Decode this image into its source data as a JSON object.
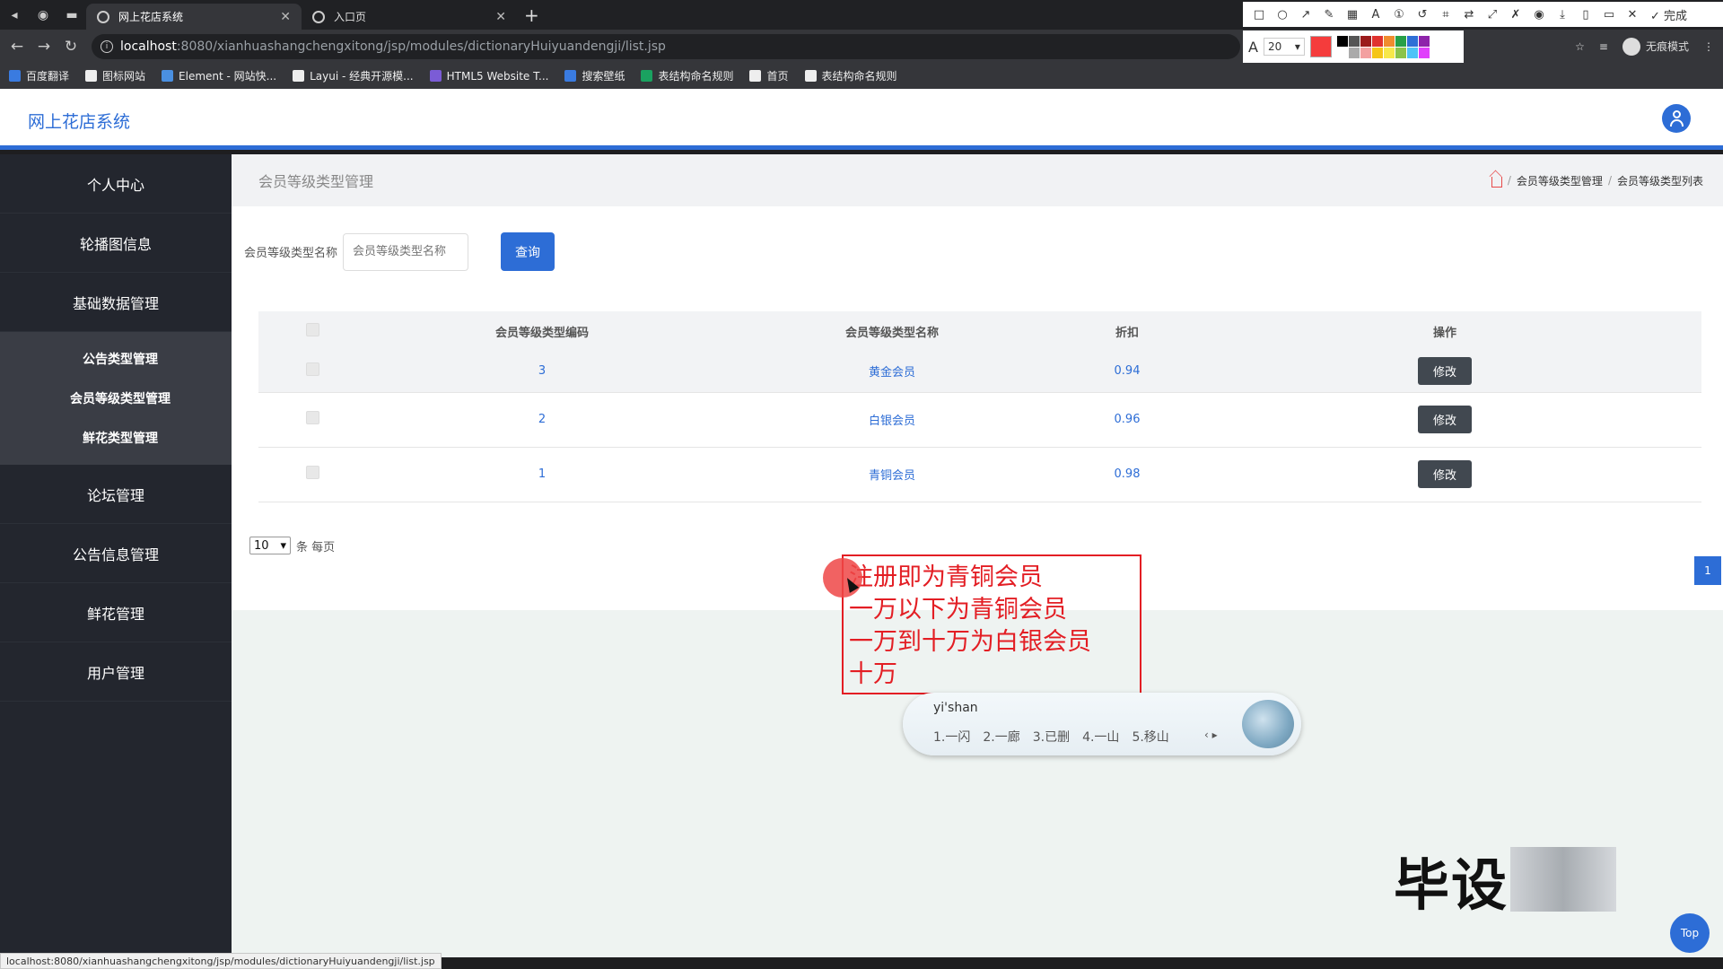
{
  "browser": {
    "tabs": [
      {
        "title": "网上花店系统",
        "active": true
      },
      {
        "title": "入口页",
        "active": false
      }
    ],
    "url_host": "localhost",
    "url_path": ":8080/xianhuashangchengxitong/jsp/modules/dictionaryHuiyuandengji/list.jsp",
    "incognito_label": "无痕模式",
    "bookmarks": [
      {
        "label": "百度翻译",
        "color": "#3a7be0"
      },
      {
        "label": "图标网站",
        "color": "#eeeeee"
      },
      {
        "label": "Element - 网站快...",
        "color": "#4a90e2"
      },
      {
        "label": "Layui - 经典开源模...",
        "color": "#eeeeee"
      },
      {
        "label": "HTML5 Website T...",
        "color": "#7b5cd6"
      },
      {
        "label": "搜索壁纸",
        "color": "#3a7be0"
      },
      {
        "label": "表结构命名规则",
        "color": "#1aa260"
      },
      {
        "label": "首页",
        "color": "#eeeeee"
      },
      {
        "label": "表结构命名规则",
        "color": "#eeeeee"
      }
    ],
    "status_url": "localhost:8080/xianhuashangchengxitong/jsp/modules/dictionaryHuiyuandengji/list.jsp"
  },
  "annotation_tool": {
    "font_size": "20",
    "done_label": "完成",
    "current_color": "#f53c3c",
    "palette": [
      "#000000",
      "#555555",
      "#9b1c1c",
      "#e0322e",
      "#f08c2e",
      "#27a047",
      "#2e6fd6",
      "#8e24aa",
      "#ffffff",
      "#aaaaaa",
      "#f3a0a0",
      "#f5c518",
      "#f7e84a",
      "#8bc34a",
      "#4fc3f7",
      "#e040fb"
    ]
  },
  "app": {
    "title": "网上花店系统"
  },
  "sidebar": {
    "items": [
      {
        "label": "个人中心"
      },
      {
        "label": "轮播图信息"
      },
      {
        "label": "基础数据管理"
      }
    ],
    "submenu": [
      {
        "label": "公告类型管理"
      },
      {
        "label": "会员等级类型管理"
      },
      {
        "label": "鲜花类型管理"
      }
    ],
    "items_after": [
      {
        "label": "论坛管理"
      },
      {
        "label": "公告信息管理"
      },
      {
        "label": "鲜花管理"
      },
      {
        "label": "用户管理"
      }
    ]
  },
  "page": {
    "title": "会员等级类型管理",
    "breadcrumb": [
      "会员等级类型管理",
      "会员等级类型列表"
    ],
    "search_label": "会员等级类型名称",
    "search_placeholder": "会员等级类型名称",
    "search_button": "查询"
  },
  "table": {
    "headers": [
      "会员等级类型编码",
      "会员等级类型名称",
      "折扣",
      "操作"
    ],
    "rows": [
      {
        "code": "3",
        "name": "黄金会员",
        "discount": "0.94",
        "action": "修改"
      },
      {
        "code": "2",
        "name": "白银会员",
        "discount": "0.96",
        "action": "修改"
      },
      {
        "code": "1",
        "name": "青铜会员",
        "discount": "0.98",
        "action": "修改"
      }
    ]
  },
  "pagination": {
    "page_size": "10",
    "per_page_label": "条 每页",
    "current_page": "1"
  },
  "note": {
    "lines": [
      "注册即为青铜会员",
      "一万以下为青铜会员",
      "一万到十万为白银会员",
      "十万"
    ]
  },
  "ime": {
    "input": "yi'shan",
    "candidates": [
      "1.一闪",
      "2.一廊",
      "3.已删",
      "4.一山",
      "5.移山"
    ]
  },
  "watermark": "毕设",
  "top_button": "Top"
}
